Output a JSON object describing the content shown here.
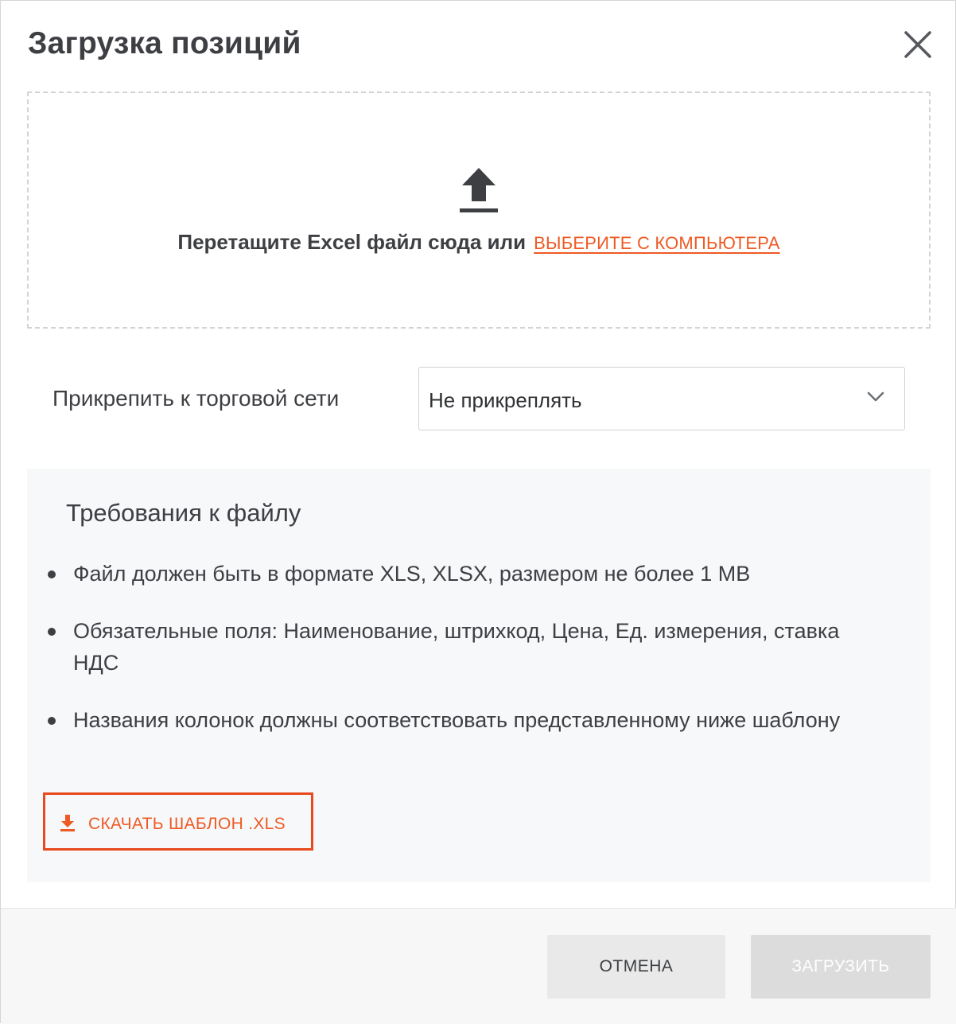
{
  "dialog": {
    "title": "Загрузка позиций",
    "close_icon": "close-icon"
  },
  "dropzone": {
    "icon": "upload-icon",
    "text": "Перетащите Excel файл сюда или",
    "choose_link": "ВЫБЕРИТЕ С КОМПЬЮТЕРА"
  },
  "attach": {
    "label": "Прикрепить к торговой сети",
    "selected": "Не прикреплять",
    "icon": "chevron-down-icon"
  },
  "requirements": {
    "title": "Требования к файлу",
    "items": [
      "Файл должен быть в формате XLS, XLSX, размером не более 1 MB",
      "Обязательные поля: Наименование, штрихкод, Цена, Ед. измерения, ставка НДС",
      "Названия колонок должны соответствовать представленному ниже шаблону"
    ],
    "download_label": "СКАЧАТЬ ШАБЛОН .XLS",
    "download_icon": "download-icon"
  },
  "footer": {
    "cancel_label": "ОТМЕНА",
    "upload_label": "ЗАГРУЗИТЬ"
  },
  "colors": {
    "accent": "#ee5a24",
    "highlight_border": "#e8491d",
    "text": "#3d3f43",
    "panel_bg": "#f7f8fa"
  }
}
